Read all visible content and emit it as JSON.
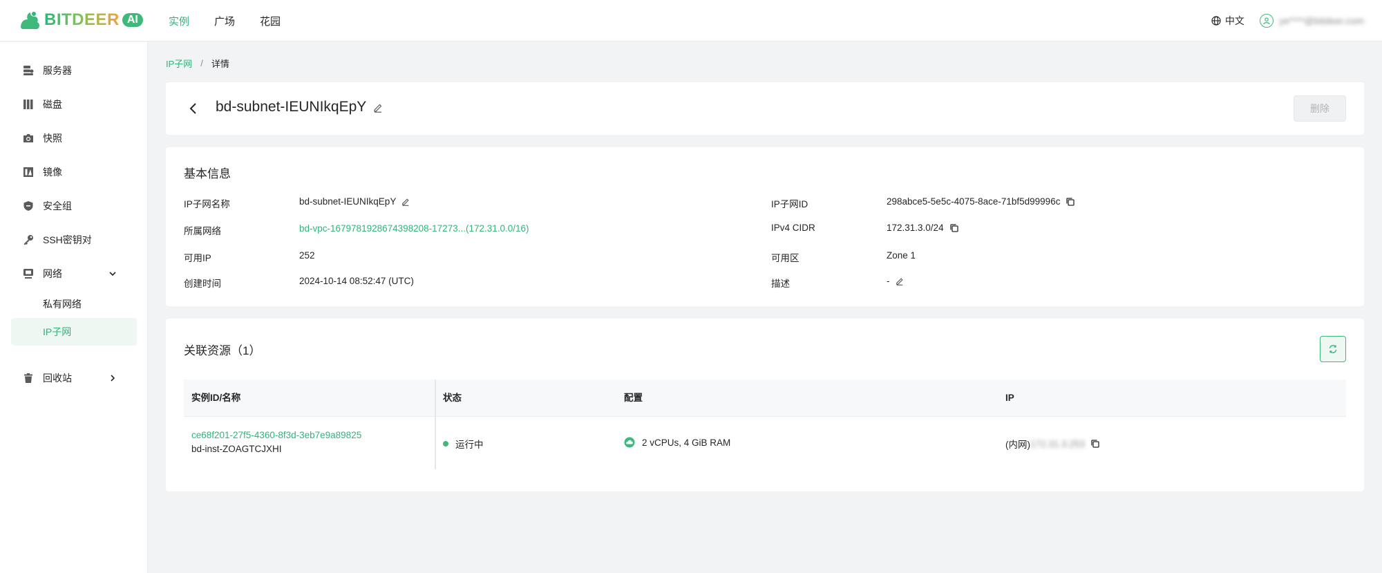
{
  "brand": {
    "name": "BITDEER",
    "ai_badge": "AI"
  },
  "topnav": {
    "items": [
      "实例",
      "广场",
      "花园"
    ],
    "active": "实例"
  },
  "top_right": {
    "language": "中文",
    "user_email": "ye****@bitdeer.com"
  },
  "sidebar": {
    "items": [
      {
        "label": "服务器",
        "icon": "server-icon"
      },
      {
        "label": "磁盘",
        "icon": "disk-icon"
      },
      {
        "label": "快照",
        "icon": "camera-icon"
      },
      {
        "label": "镜像",
        "icon": "image-icon"
      },
      {
        "label": "安全组",
        "icon": "shield-icon"
      },
      {
        "label": "SSH密钥对",
        "icon": "key-icon"
      },
      {
        "label": "网络",
        "icon": "network-icon",
        "expanded": true
      },
      {
        "label": "回收站",
        "icon": "trash-icon"
      }
    ],
    "network_sub": [
      "私有网络",
      "IP子网"
    ],
    "active_sub": "IP子网"
  },
  "breadcrumb": {
    "parent": "IP子网",
    "separator": "/",
    "current": "详情"
  },
  "header": {
    "title": "bd-subnet-IEUNIkqEpY",
    "delete_label": "删除"
  },
  "basic_info": {
    "title": "基本信息",
    "left": [
      {
        "label": "IP子网名称",
        "value": "bd-subnet-IEUNIkqEpY"
      },
      {
        "label": "所属网络",
        "value": "bd-vpc-1679781928674398208-17273...(172.31.0.0/16)"
      },
      {
        "label": "可用IP",
        "value": "252"
      },
      {
        "label": "创建时间",
        "value": "2024-10-14 08:52:47 (UTC)"
      }
    ],
    "right": [
      {
        "label": "IP子网ID",
        "value": "298abce5-5e5c-4075-8ace-71bf5d99996c"
      },
      {
        "label": "IPv4 CIDR",
        "value": "172.31.3.0/24"
      },
      {
        "label": "可用区",
        "value": "Zone 1"
      },
      {
        "label": "描述",
        "value": "-"
      }
    ]
  },
  "resources": {
    "title": "关联资源（1）",
    "columns": [
      "实例ID/名称",
      "状态",
      "配置",
      "IP"
    ],
    "rows": [
      {
        "instance_id": "ce68f201-27f5-4360-8f3d-3eb7e9a89825",
        "instance_name": "bd-inst-ZOAGTCJXHI",
        "status": "运行中",
        "config": "2 vCPUs, 4 GiB RAM",
        "ip_prefix": "(内网)",
        "ip_value": "172.31.3.253"
      }
    ]
  },
  "colors": {
    "accent": "#2fb47c",
    "running": "#3fb97a",
    "disabled_bg": "#f0f1f3"
  }
}
